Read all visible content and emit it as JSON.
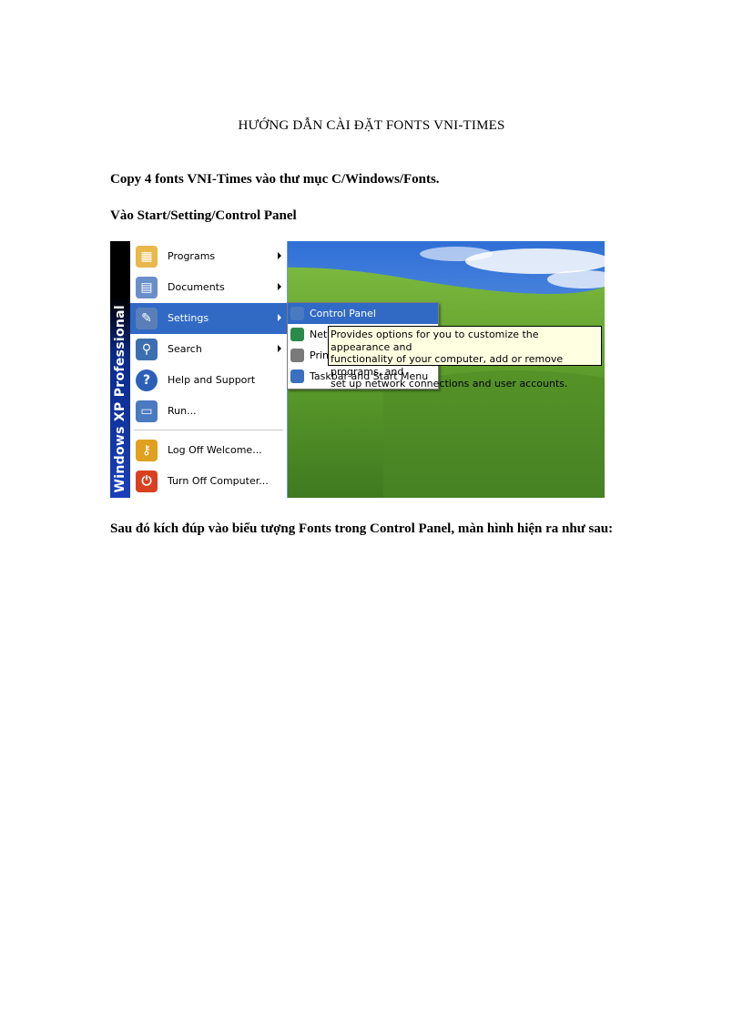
{
  "document": {
    "title": "HƯỚNG DẪN CÀI ĐẶT FONTS VNI-TIMES",
    "paragraphs": [
      "Copy 4 fonts VNI-Times vào thư mục  C/Windows/Fonts.",
      "Vào Start/Setting/Control  Panel",
      "Sau đó kích đúp vào biểu tượng Fonts trong Control Panel, màn hình hiện ra như sau:"
    ]
  },
  "screenshot": {
    "banner_text": "Windows XP Professional",
    "start_menu": [
      {
        "label": "Programs",
        "icon": "programs-icon",
        "arrow": true,
        "color": "#e8b84a"
      },
      {
        "label": "Documents",
        "icon": "documents-icon",
        "arrow": true,
        "color": "#6a8fc8"
      },
      {
        "label": "Settings",
        "icon": "settings-icon",
        "arrow": true,
        "selected": true,
        "color": "#5a7fb8"
      },
      {
        "label": "Search",
        "icon": "search-icon",
        "arrow": true,
        "color": "#3c6fb0"
      },
      {
        "label": "Help and Support",
        "icon": "help-icon",
        "arrow": false,
        "color": "#2d5fb8"
      },
      {
        "label": "Run...",
        "icon": "run-icon",
        "arrow": false,
        "color": "#4a7ac0"
      },
      {
        "label": "Log Off Welcome...",
        "icon": "logoff-icon",
        "arrow": false,
        "color": "#e0a020"
      },
      {
        "label": "Turn Off Computer...",
        "icon": "power-icon",
        "arrow": false,
        "color": "#d84020"
      }
    ],
    "submenu": [
      {
        "label": "Control Panel",
        "icon": "control-panel-icon",
        "selected": true,
        "color": "#4a7ac0"
      },
      {
        "label": "Netw",
        "icon": "network-icon",
        "color": "#2a8a4a"
      },
      {
        "label": "Print",
        "icon": "printer-icon",
        "color": "#7a7a7a"
      },
      {
        "label": "Taskbar and Start Menu",
        "icon": "taskbar-icon",
        "color": "#3a70c0"
      }
    ],
    "tooltip": [
      "Provides options for you to customize the appearance and",
      "functionality of your computer, add or remove programs, and",
      "set up network connections and user accounts."
    ],
    "colors": {
      "selection": "#316ac5",
      "tooltip_bg": "#ffffe1",
      "sky": "#4a86e0",
      "grass": "#5e9a2e"
    }
  }
}
